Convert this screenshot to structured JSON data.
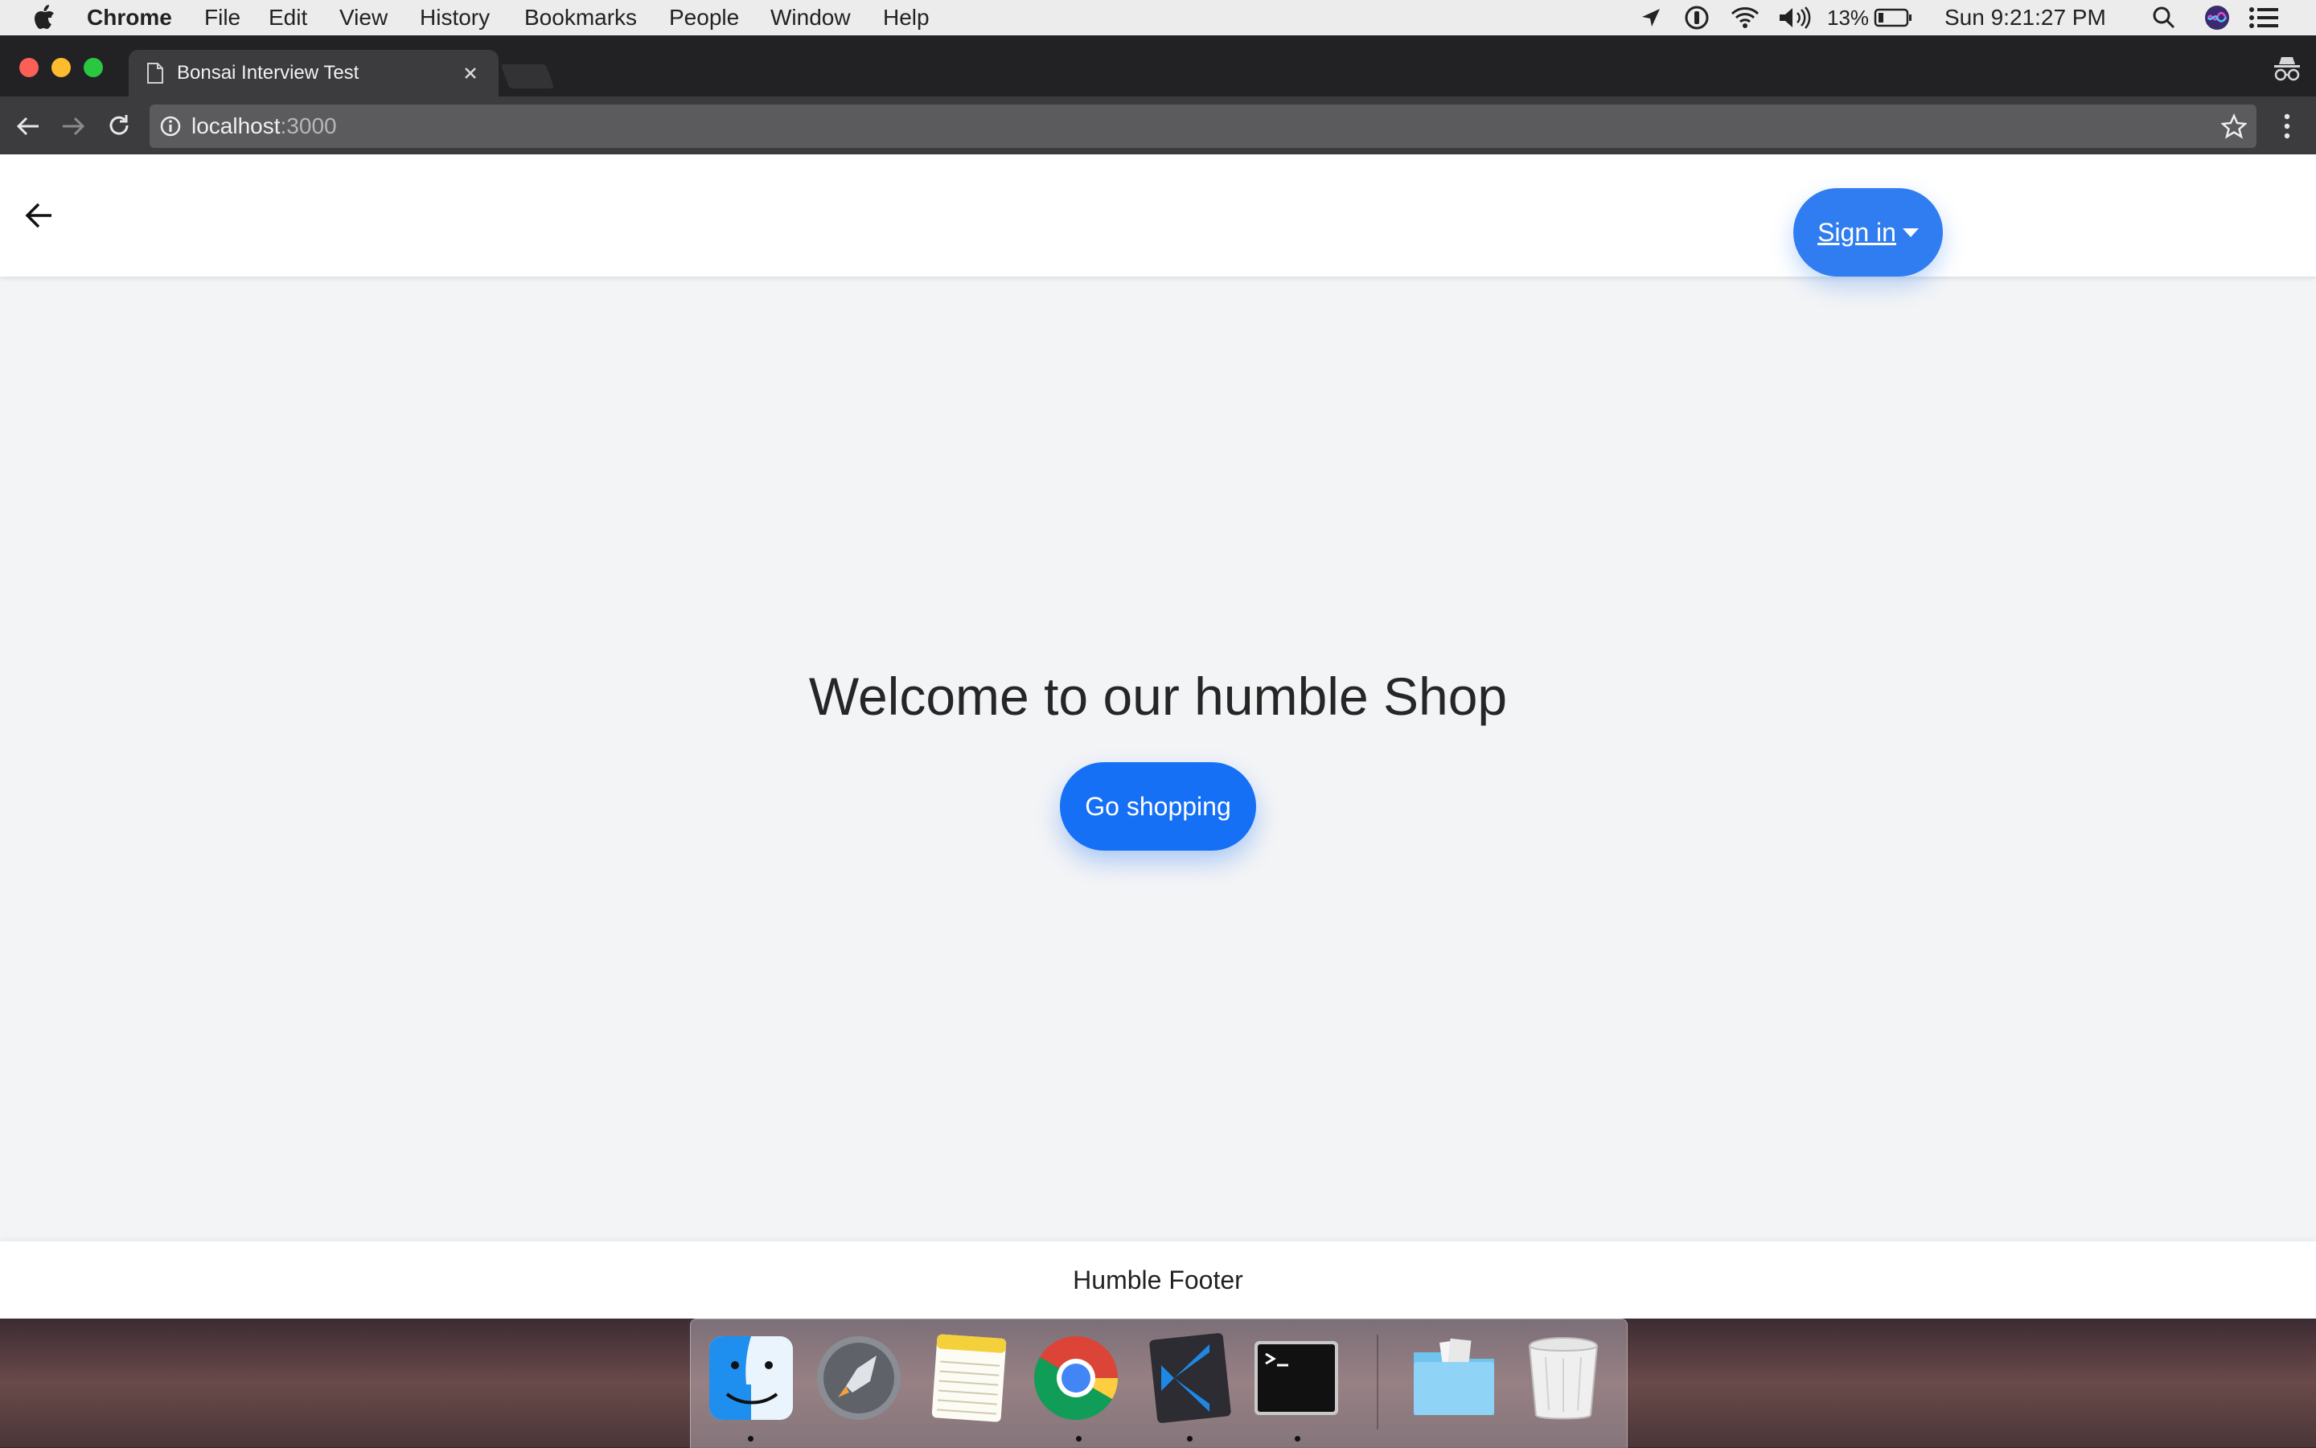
{
  "menubar": {
    "app_name": "Chrome",
    "menus": [
      "File",
      "Edit",
      "View",
      "History",
      "Bookmarks",
      "People",
      "Window",
      "Help"
    ],
    "battery": "13%",
    "clock": "Sun 9:21:27 PM"
  },
  "browser": {
    "tab_title": "Bonsai Interview Test",
    "url_host": "localhost",
    "url_port": ":3000"
  },
  "header": {
    "signin_label": "Sign in"
  },
  "main": {
    "heading": "Welcome to our humble Shop",
    "cta_label": "Go shopping"
  },
  "footer": {
    "text": "Humble Footer"
  },
  "dock": {
    "apps": [
      "finder-icon",
      "launchpad-icon",
      "notes-icon",
      "chrome-icon",
      "vscode-icon",
      "terminal-icon",
      "downloads-folder-icon",
      "trash-icon"
    ]
  },
  "colors": {
    "primary_button": "#1670f5",
    "signin_button": "#2f7df0",
    "page_background": "#f3f4f6"
  }
}
